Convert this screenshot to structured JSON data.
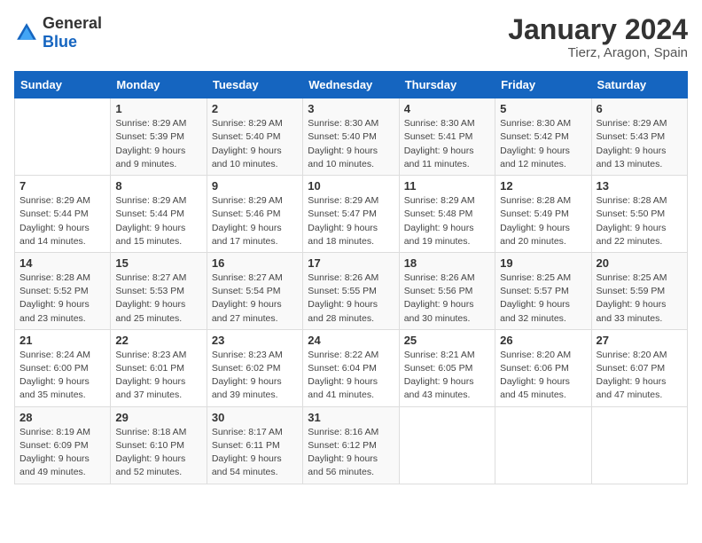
{
  "logo": {
    "general": "General",
    "blue": "Blue"
  },
  "title": "January 2024",
  "subtitle": "Tierz, Aragon, Spain",
  "days_of_week": [
    "Sunday",
    "Monday",
    "Tuesday",
    "Wednesday",
    "Thursday",
    "Friday",
    "Saturday"
  ],
  "weeks": [
    [
      {
        "day": "",
        "sunrise": "",
        "sunset": "",
        "daylight": ""
      },
      {
        "day": "1",
        "sunrise": "Sunrise: 8:29 AM",
        "sunset": "Sunset: 5:39 PM",
        "daylight": "Daylight: 9 hours and 9 minutes."
      },
      {
        "day": "2",
        "sunrise": "Sunrise: 8:29 AM",
        "sunset": "Sunset: 5:40 PM",
        "daylight": "Daylight: 9 hours and 10 minutes."
      },
      {
        "day": "3",
        "sunrise": "Sunrise: 8:30 AM",
        "sunset": "Sunset: 5:40 PM",
        "daylight": "Daylight: 9 hours and 10 minutes."
      },
      {
        "day": "4",
        "sunrise": "Sunrise: 8:30 AM",
        "sunset": "Sunset: 5:41 PM",
        "daylight": "Daylight: 9 hours and 11 minutes."
      },
      {
        "day": "5",
        "sunrise": "Sunrise: 8:30 AM",
        "sunset": "Sunset: 5:42 PM",
        "daylight": "Daylight: 9 hours and 12 minutes."
      },
      {
        "day": "6",
        "sunrise": "Sunrise: 8:29 AM",
        "sunset": "Sunset: 5:43 PM",
        "daylight": "Daylight: 9 hours and 13 minutes."
      }
    ],
    [
      {
        "day": "7",
        "sunrise": "Sunrise: 8:29 AM",
        "sunset": "Sunset: 5:44 PM",
        "daylight": "Daylight: 9 hours and 14 minutes."
      },
      {
        "day": "8",
        "sunrise": "Sunrise: 8:29 AM",
        "sunset": "Sunset: 5:44 PM",
        "daylight": "Daylight: 9 hours and 15 minutes."
      },
      {
        "day": "9",
        "sunrise": "Sunrise: 8:29 AM",
        "sunset": "Sunset: 5:46 PM",
        "daylight": "Daylight: 9 hours and 17 minutes."
      },
      {
        "day": "10",
        "sunrise": "Sunrise: 8:29 AM",
        "sunset": "Sunset: 5:47 PM",
        "daylight": "Daylight: 9 hours and 18 minutes."
      },
      {
        "day": "11",
        "sunrise": "Sunrise: 8:29 AM",
        "sunset": "Sunset: 5:48 PM",
        "daylight": "Daylight: 9 hours and 19 minutes."
      },
      {
        "day": "12",
        "sunrise": "Sunrise: 8:28 AM",
        "sunset": "Sunset: 5:49 PM",
        "daylight": "Daylight: 9 hours and 20 minutes."
      },
      {
        "day": "13",
        "sunrise": "Sunrise: 8:28 AM",
        "sunset": "Sunset: 5:50 PM",
        "daylight": "Daylight: 9 hours and 22 minutes."
      }
    ],
    [
      {
        "day": "14",
        "sunrise": "Sunrise: 8:28 AM",
        "sunset": "Sunset: 5:52 PM",
        "daylight": "Daylight: 9 hours and 23 minutes."
      },
      {
        "day": "15",
        "sunrise": "Sunrise: 8:27 AM",
        "sunset": "Sunset: 5:53 PM",
        "daylight": "Daylight: 9 hours and 25 minutes."
      },
      {
        "day": "16",
        "sunrise": "Sunrise: 8:27 AM",
        "sunset": "Sunset: 5:54 PM",
        "daylight": "Daylight: 9 hours and 27 minutes."
      },
      {
        "day": "17",
        "sunrise": "Sunrise: 8:26 AM",
        "sunset": "Sunset: 5:55 PM",
        "daylight": "Daylight: 9 hours and 28 minutes."
      },
      {
        "day": "18",
        "sunrise": "Sunrise: 8:26 AM",
        "sunset": "Sunset: 5:56 PM",
        "daylight": "Daylight: 9 hours and 30 minutes."
      },
      {
        "day": "19",
        "sunrise": "Sunrise: 8:25 AM",
        "sunset": "Sunset: 5:57 PM",
        "daylight": "Daylight: 9 hours and 32 minutes."
      },
      {
        "day": "20",
        "sunrise": "Sunrise: 8:25 AM",
        "sunset": "Sunset: 5:59 PM",
        "daylight": "Daylight: 9 hours and 33 minutes."
      }
    ],
    [
      {
        "day": "21",
        "sunrise": "Sunrise: 8:24 AM",
        "sunset": "Sunset: 6:00 PM",
        "daylight": "Daylight: 9 hours and 35 minutes."
      },
      {
        "day": "22",
        "sunrise": "Sunrise: 8:23 AM",
        "sunset": "Sunset: 6:01 PM",
        "daylight": "Daylight: 9 hours and 37 minutes."
      },
      {
        "day": "23",
        "sunrise": "Sunrise: 8:23 AM",
        "sunset": "Sunset: 6:02 PM",
        "daylight": "Daylight: 9 hours and 39 minutes."
      },
      {
        "day": "24",
        "sunrise": "Sunrise: 8:22 AM",
        "sunset": "Sunset: 6:04 PM",
        "daylight": "Daylight: 9 hours and 41 minutes."
      },
      {
        "day": "25",
        "sunrise": "Sunrise: 8:21 AM",
        "sunset": "Sunset: 6:05 PM",
        "daylight": "Daylight: 9 hours and 43 minutes."
      },
      {
        "day": "26",
        "sunrise": "Sunrise: 8:20 AM",
        "sunset": "Sunset: 6:06 PM",
        "daylight": "Daylight: 9 hours and 45 minutes."
      },
      {
        "day": "27",
        "sunrise": "Sunrise: 8:20 AM",
        "sunset": "Sunset: 6:07 PM",
        "daylight": "Daylight: 9 hours and 47 minutes."
      }
    ],
    [
      {
        "day": "28",
        "sunrise": "Sunrise: 8:19 AM",
        "sunset": "Sunset: 6:09 PM",
        "daylight": "Daylight: 9 hours and 49 minutes."
      },
      {
        "day": "29",
        "sunrise": "Sunrise: 8:18 AM",
        "sunset": "Sunset: 6:10 PM",
        "daylight": "Daylight: 9 hours and 52 minutes."
      },
      {
        "day": "30",
        "sunrise": "Sunrise: 8:17 AM",
        "sunset": "Sunset: 6:11 PM",
        "daylight": "Daylight: 9 hours and 54 minutes."
      },
      {
        "day": "31",
        "sunrise": "Sunrise: 8:16 AM",
        "sunset": "Sunset: 6:12 PM",
        "daylight": "Daylight: 9 hours and 56 minutes."
      },
      {
        "day": "",
        "sunrise": "",
        "sunset": "",
        "daylight": ""
      },
      {
        "day": "",
        "sunrise": "",
        "sunset": "",
        "daylight": ""
      },
      {
        "day": "",
        "sunrise": "",
        "sunset": "",
        "daylight": ""
      }
    ]
  ]
}
